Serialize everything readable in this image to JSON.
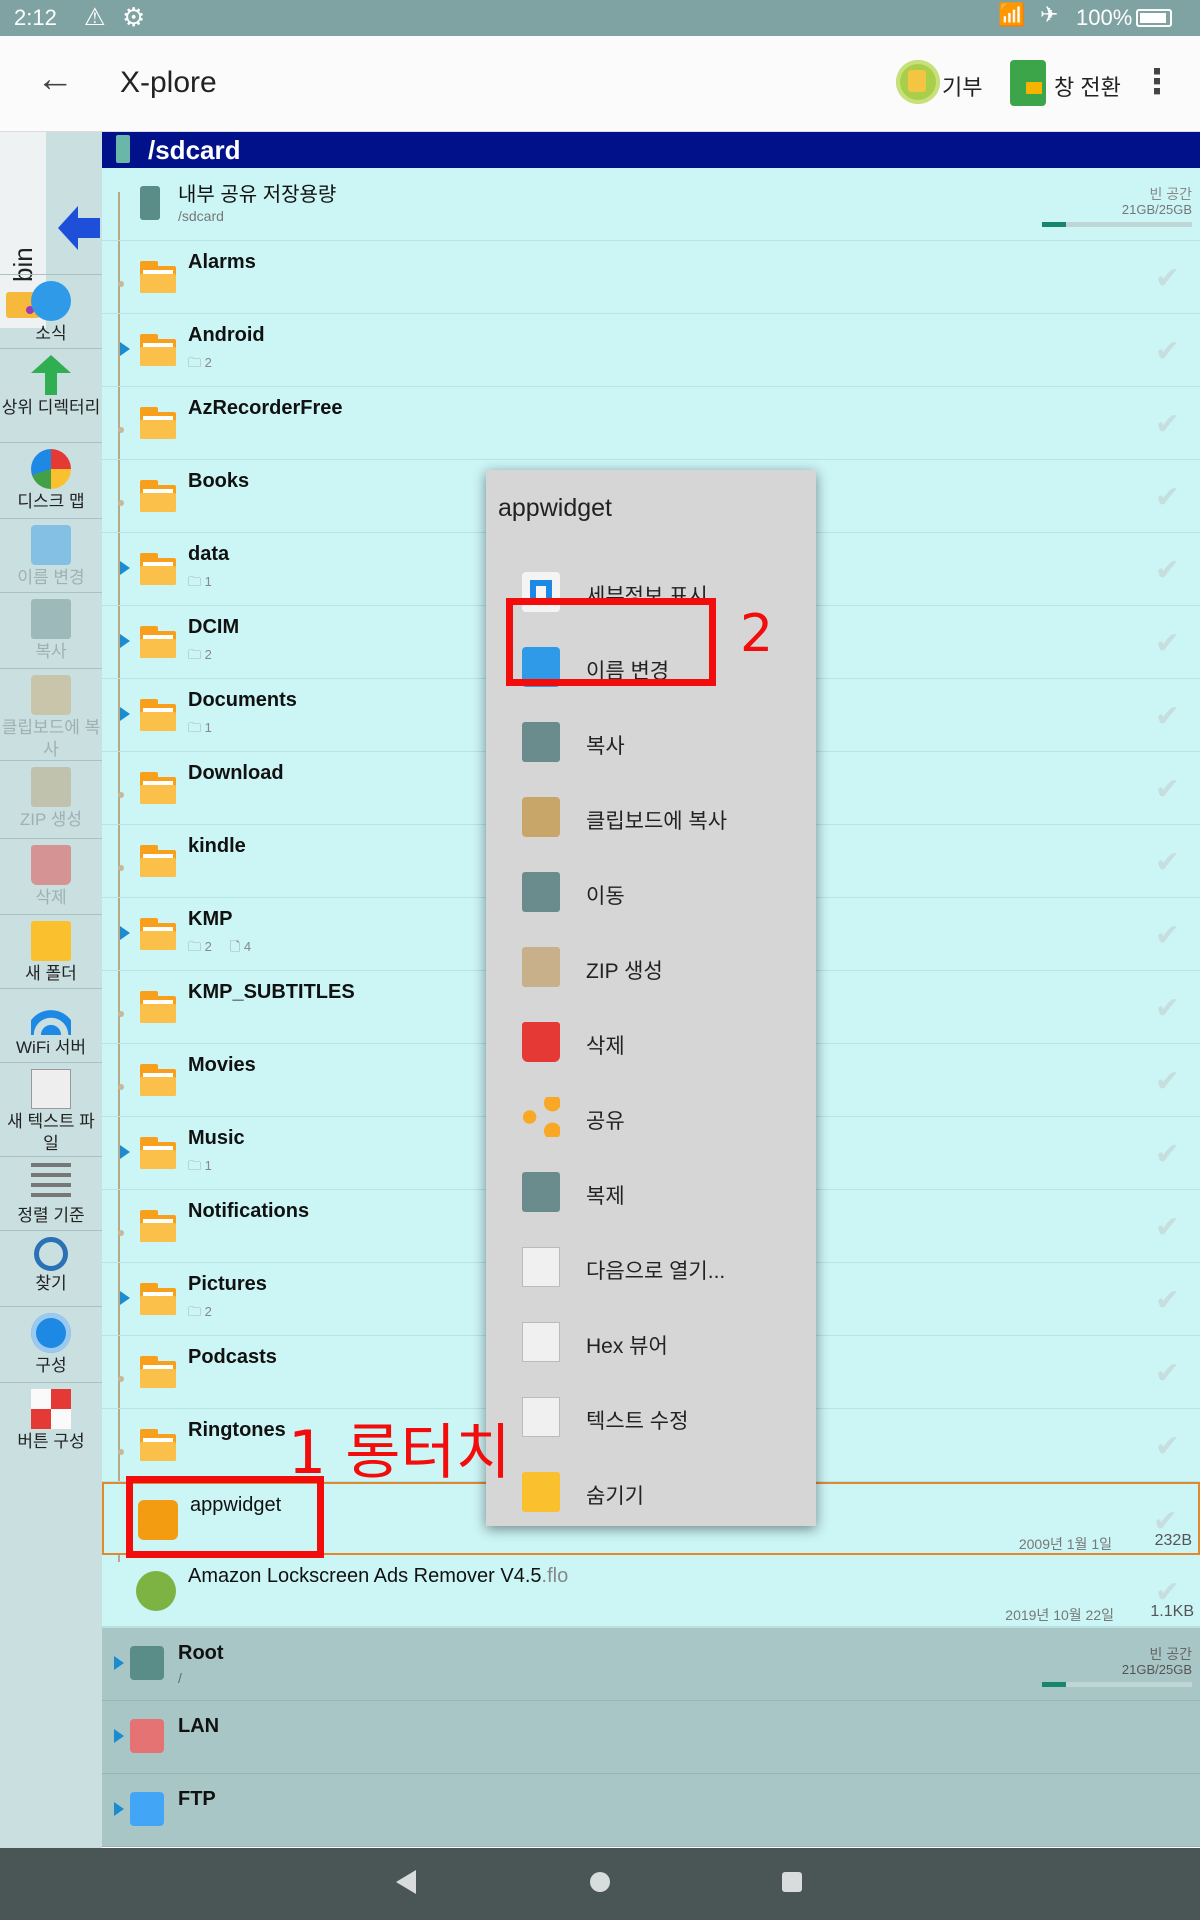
{
  "status_bar": {
    "time": "2:12",
    "battery": "100%"
  },
  "app_bar": {
    "title": "X-plore",
    "donate_label": "기부",
    "switch_label": "창 전환"
  },
  "sidebar": {
    "bin_label": "bin",
    "buttons": [
      {
        "label": "소식",
        "icon": "info-icon",
        "disabled": false
      },
      {
        "label": "상위 디렉터리",
        "icon": "up-arrow-icon",
        "disabled": false
      },
      {
        "label": "디스크 맵",
        "icon": "disk-map-icon",
        "disabled": false
      },
      {
        "label": "이름 변경",
        "icon": "rename-icon",
        "disabled": true
      },
      {
        "label": "복사",
        "icon": "copy-icon",
        "disabled": true
      },
      {
        "label": "클립보드에 복사",
        "icon": "clipboard-icon",
        "disabled": true
      },
      {
        "label": "ZIP 생성",
        "icon": "zip-icon",
        "disabled": true
      },
      {
        "label": "삭제",
        "icon": "trash-icon",
        "disabled": true
      },
      {
        "label": "새 폴더",
        "icon": "new-folder-icon",
        "disabled": false
      },
      {
        "label": "WiFi 서버",
        "icon": "wifi-icon",
        "disabled": false
      },
      {
        "label": "새 텍스트 파일",
        "icon": "new-text-file-icon",
        "disabled": false
      },
      {
        "label": "정렬 기준",
        "icon": "sort-icon",
        "disabled": false
      },
      {
        "label": "찾기",
        "icon": "search-icon",
        "disabled": false
      },
      {
        "label": "구성",
        "icon": "settings-icon",
        "disabled": false
      },
      {
        "label": "버튼 구성",
        "icon": "button-config-icon",
        "disabled": false
      }
    ]
  },
  "panel": {
    "path": "/sdcard",
    "storage": {
      "name": "내부 공유 저장용량",
      "path": "/sdcard",
      "free_label": "빈 공간",
      "free_value": "21GB/25GB",
      "used_fraction": 0.16
    },
    "folders": [
      {
        "name": "Alarms",
        "expandable": false,
        "folders": "",
        "files": ""
      },
      {
        "name": "Android",
        "expandable": true,
        "folders": "2",
        "files": ""
      },
      {
        "name": "AzRecorderFree",
        "expandable": false,
        "folders": "",
        "files": ""
      },
      {
        "name": "Books",
        "expandable": false,
        "folders": "",
        "files": ""
      },
      {
        "name": "data",
        "expandable": true,
        "folders": "1",
        "files": ""
      },
      {
        "name": "DCIM",
        "expandable": true,
        "folders": "2",
        "files": ""
      },
      {
        "name": "Documents",
        "expandable": true,
        "folders": "1",
        "files": ""
      },
      {
        "name": "Download",
        "expandable": false,
        "folders": "",
        "files": ""
      },
      {
        "name": "kindle",
        "expandable": false,
        "folders": "",
        "files": ""
      },
      {
        "name": "KMP",
        "expandable": true,
        "folders": "2",
        "files": "4"
      },
      {
        "name": "KMP_SUBTITLES",
        "expandable": false,
        "folders": "",
        "files": ""
      },
      {
        "name": "Movies",
        "expandable": false,
        "folders": "",
        "files": ""
      },
      {
        "name": "Music",
        "expandable": true,
        "folders": "1",
        "files": ""
      },
      {
        "name": "Notifications",
        "expandable": false,
        "folders": "",
        "files": ""
      },
      {
        "name": "Pictures",
        "expandable": true,
        "folders": "2",
        "files": ""
      },
      {
        "name": "Podcasts",
        "expandable": false,
        "folders": "",
        "files": ""
      },
      {
        "name": "Ringtones",
        "expandable": false,
        "folders": "",
        "files": ""
      }
    ],
    "files": [
      {
        "name": "appwidget",
        "ext": "",
        "date": "2009년 1월 1일",
        "size": "232B",
        "selected": true
      },
      {
        "name": "Amazon Lockscreen Ads Remover V4.5",
        "ext": ".flo",
        "date": "2019년 10월 22일",
        "size": "1.1KB",
        "selected": false
      }
    ]
  },
  "bottom_groups": [
    {
      "name": "Root",
      "sub": "/",
      "free_label": "빈 공간",
      "free_value": "21GB/25GB",
      "used_fraction": 0.16
    },
    {
      "name": "LAN",
      "sub": ""
    },
    {
      "name": "FTP",
      "sub": ""
    }
  ],
  "context_menu": {
    "title": "appwidget",
    "items": [
      {
        "label": "세부정보 표시",
        "icon": "details-icon"
      },
      {
        "label": "이름 변경",
        "icon": "rename-icon"
      },
      {
        "label": "복사",
        "icon": "copy-icon"
      },
      {
        "label": "클립보드에 복사",
        "icon": "clipboard-icon"
      },
      {
        "label": "이동",
        "icon": "move-icon"
      },
      {
        "label": "ZIP 생성",
        "icon": "zip-icon"
      },
      {
        "label": "삭제",
        "icon": "trash-icon"
      },
      {
        "label": "공유",
        "icon": "share-icon"
      },
      {
        "label": "복제",
        "icon": "duplicate-icon"
      },
      {
        "label": "다음으로 열기...",
        "icon": "open-with-icon"
      },
      {
        "label": "Hex 뷰어",
        "icon": "hex-viewer-icon"
      },
      {
        "label": "텍스트 수정",
        "icon": "text-edit-icon"
      },
      {
        "label": "숨기기",
        "icon": "hide-icon"
      }
    ]
  },
  "annotations": {
    "step1": "1 롱터치",
    "step2": "2"
  },
  "colors": {
    "path_bar": "#00118a",
    "panel_bg": "#ccf5f5",
    "annotation_red": "#f30c0c",
    "selection_orange": "#e0892e"
  }
}
